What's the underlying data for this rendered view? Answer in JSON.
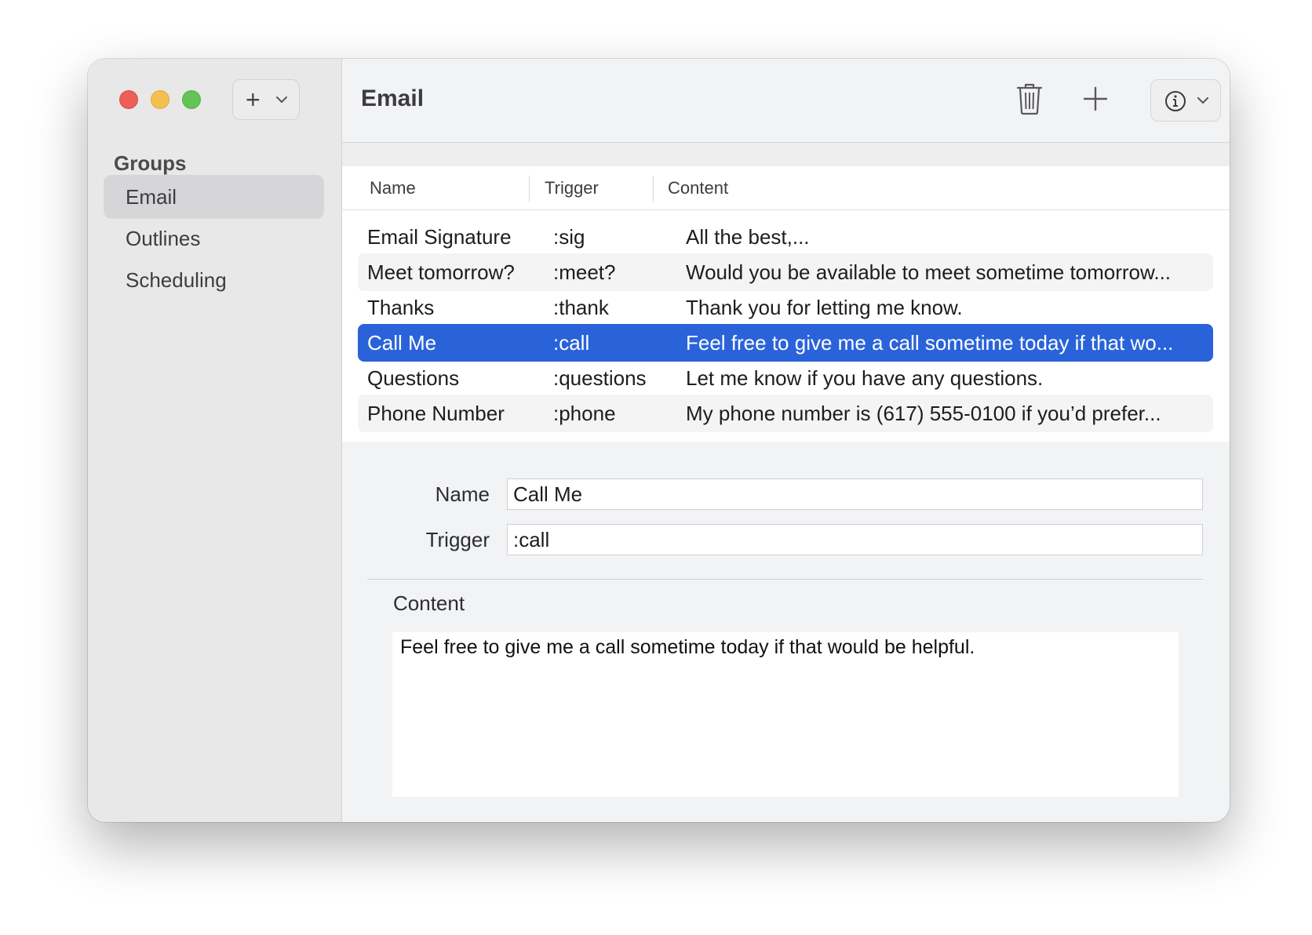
{
  "window": {
    "add_group_icon": "plus-icon",
    "sidebar": {
      "heading": "Groups",
      "items": [
        {
          "label": "Email",
          "selected": true
        },
        {
          "label": "Outlines",
          "selected": false
        },
        {
          "label": "Scheduling",
          "selected": false
        }
      ]
    },
    "toolbar": {
      "title": "Email",
      "trash_icon": "trash-icon",
      "add_icon": "plus-icon",
      "info_icon": "info-icon"
    },
    "table": {
      "columns": [
        "Name",
        "Trigger",
        "Content"
      ],
      "rows": [
        {
          "name": "Email Signature",
          "trigger": ":sig",
          "content": "All the best,..."
        },
        {
          "name": "Meet tomorrow?",
          "trigger": ":meet?",
          "content": "Would you be available to meet sometime tomorrow..."
        },
        {
          "name": "Thanks",
          "trigger": ":thank",
          "content": "Thank you for letting me know."
        },
        {
          "name": "Call Me",
          "trigger": ":call",
          "content": "Feel free to give me a call sometime today if that wo...",
          "selected": true
        },
        {
          "name": "Questions",
          "trigger": ":questions",
          "content": "Let me know if you have any questions."
        },
        {
          "name": "Phone Number",
          "trigger": ":phone",
          "content": "My phone number is (617) 555-0100 if you’d prefer..."
        }
      ]
    },
    "detail": {
      "name_label": "Name",
      "name_value": "Call Me",
      "trigger_label": "Trigger",
      "trigger_value": ":call",
      "content_label": "Content",
      "content_value": "Feel free to give me a call sometime today if that would be helpful."
    },
    "colors": {
      "selection": "#2a63d9",
      "close": "#ec5f57",
      "minimize": "#f4bf4f",
      "zoom": "#61c454"
    }
  }
}
